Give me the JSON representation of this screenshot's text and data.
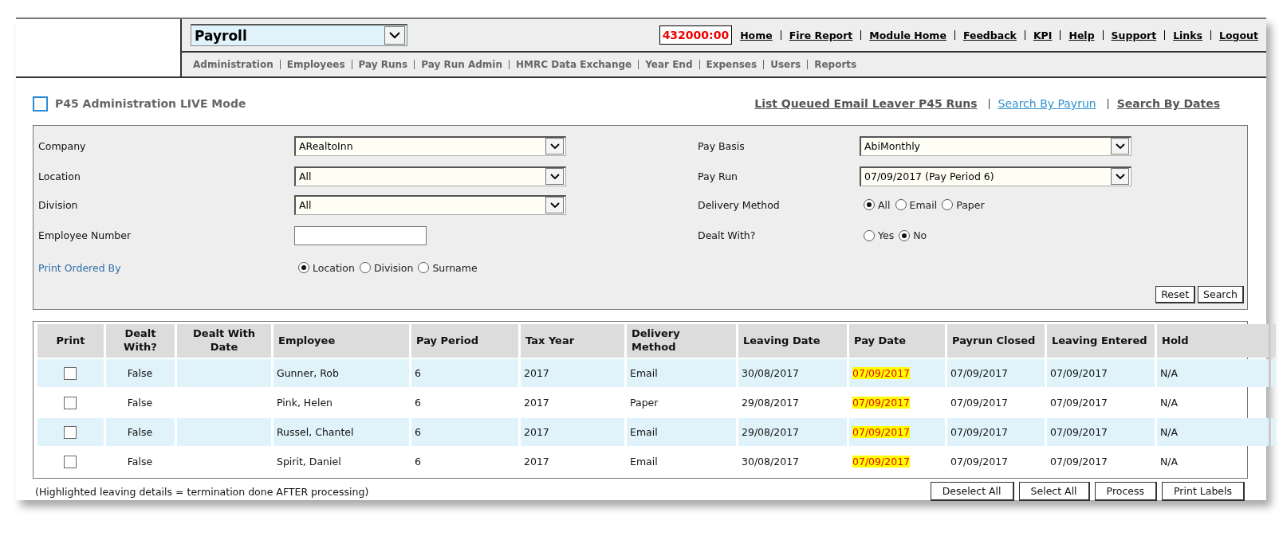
{
  "module_select": {
    "value": "Payroll"
  },
  "timer": "432000:00",
  "top_links": [
    "Home",
    "Fire Report",
    "Module Home",
    "Feedback",
    "KPI",
    "Help",
    "Support",
    "Links",
    "Logout"
  ],
  "sub_nav": [
    "Administration",
    "Employees",
    "Pay Runs",
    "Pay Run Admin",
    "HMRC Data Exchange",
    "Year End",
    "Expenses",
    "Users",
    "Reports"
  ],
  "page_title": "P45 Administration LIVE Mode",
  "action_links": [
    {
      "label": "List Queued Email Leaver P45 Runs",
      "kind": "bold"
    },
    {
      "label": "Search By Payrun",
      "kind": "plain"
    },
    {
      "label": "Search By Dates",
      "kind": "bold"
    }
  ],
  "filters_left": [
    {
      "label": "Company",
      "link": false,
      "kind": "select",
      "value": "ARealtoInn"
    },
    {
      "label": "Location",
      "link": false,
      "kind": "select",
      "value": "All"
    },
    {
      "label": "Division",
      "link": false,
      "kind": "select",
      "value": "All"
    },
    {
      "label": "Employee Number",
      "link": false,
      "kind": "text"
    },
    {
      "label": "Print Ordered By",
      "link": true,
      "kind": "radio",
      "options": [
        {
          "label": "Location",
          "selected": true
        },
        {
          "label": "Division",
          "selected": false
        },
        {
          "label": "Surname",
          "selected": false
        }
      ]
    }
  ],
  "filters_right": [
    {
      "label": "Pay Basis",
      "link": false,
      "kind": "select",
      "value": "AbiMonthly"
    },
    {
      "label": "Pay Run",
      "link": false,
      "kind": "select",
      "value": "07/09/2017 (Pay Period 6)"
    },
    {
      "label": "Delivery Method",
      "link": false,
      "kind": "radio",
      "options": [
        {
          "label": "All",
          "selected": true
        },
        {
          "label": "Email",
          "selected": false
        },
        {
          "label": "Paper",
          "selected": false
        }
      ]
    },
    {
      "label": "Dealt With?",
      "link": false,
      "kind": "radio",
      "options": [
        {
          "label": "Yes",
          "selected": false
        },
        {
          "label": "No",
          "selected": true
        }
      ]
    }
  ],
  "filter_buttons": [
    "Reset",
    "Search"
  ],
  "table": {
    "columns": [
      "Print",
      "Dealt With?",
      "Dealt With Date",
      "Employee",
      "Pay Period",
      "Tax Year",
      "Delivery Method",
      "Leaving Date",
      "Pay Date",
      "Payrun Closed",
      "Leaving Entered",
      "Hold"
    ],
    "rows": [
      {
        "checked": false,
        "dealt_with": "False",
        "employee": "Gunner, Rob",
        "pay_period": "6",
        "tax_year": "2017",
        "delivery": "Email",
        "leaving_date": "30/08/2017",
        "pay_date": "07/09/2017",
        "pay_date_highlighted": true,
        "payrun_closed": "07/09/2017",
        "leaving_entered": "07/09/2017",
        "hold": "N/A"
      },
      {
        "checked": false,
        "dealt_with": "False",
        "employee": "Pink, Helen",
        "pay_period": "6",
        "tax_year": "2017",
        "delivery": "Paper",
        "leaving_date": "29/08/2017",
        "pay_date": "07/09/2017",
        "pay_date_highlighted": true,
        "payrun_closed": "07/09/2017",
        "leaving_entered": "07/09/2017",
        "hold": "N/A"
      },
      {
        "checked": false,
        "dealt_with": "False",
        "employee": "Russel, Chantel",
        "pay_period": "6",
        "tax_year": "2017",
        "delivery": "Email",
        "leaving_date": "29/08/2017",
        "pay_date": "07/09/2017",
        "pay_date_highlighted": true,
        "payrun_closed": "07/09/2017",
        "leaving_entered": "07/09/2017",
        "hold": "N/A"
      },
      {
        "checked": false,
        "dealt_with": "False",
        "employee": "Spirit, Daniel",
        "pay_period": "6",
        "tax_year": "2017",
        "delivery": "Email",
        "leaving_date": "30/08/2017",
        "pay_date": "07/09/2017",
        "pay_date_highlighted": true,
        "payrun_closed": "07/09/2017",
        "leaving_entered": "07/09/2017",
        "hold": "N/A"
      }
    ]
  },
  "footer_note": "(Highlighted leaving details = termination done AFTER processing)",
  "footer_buttons": [
    "Deselect All",
    "Select All",
    "Process",
    "Print Labels"
  ]
}
